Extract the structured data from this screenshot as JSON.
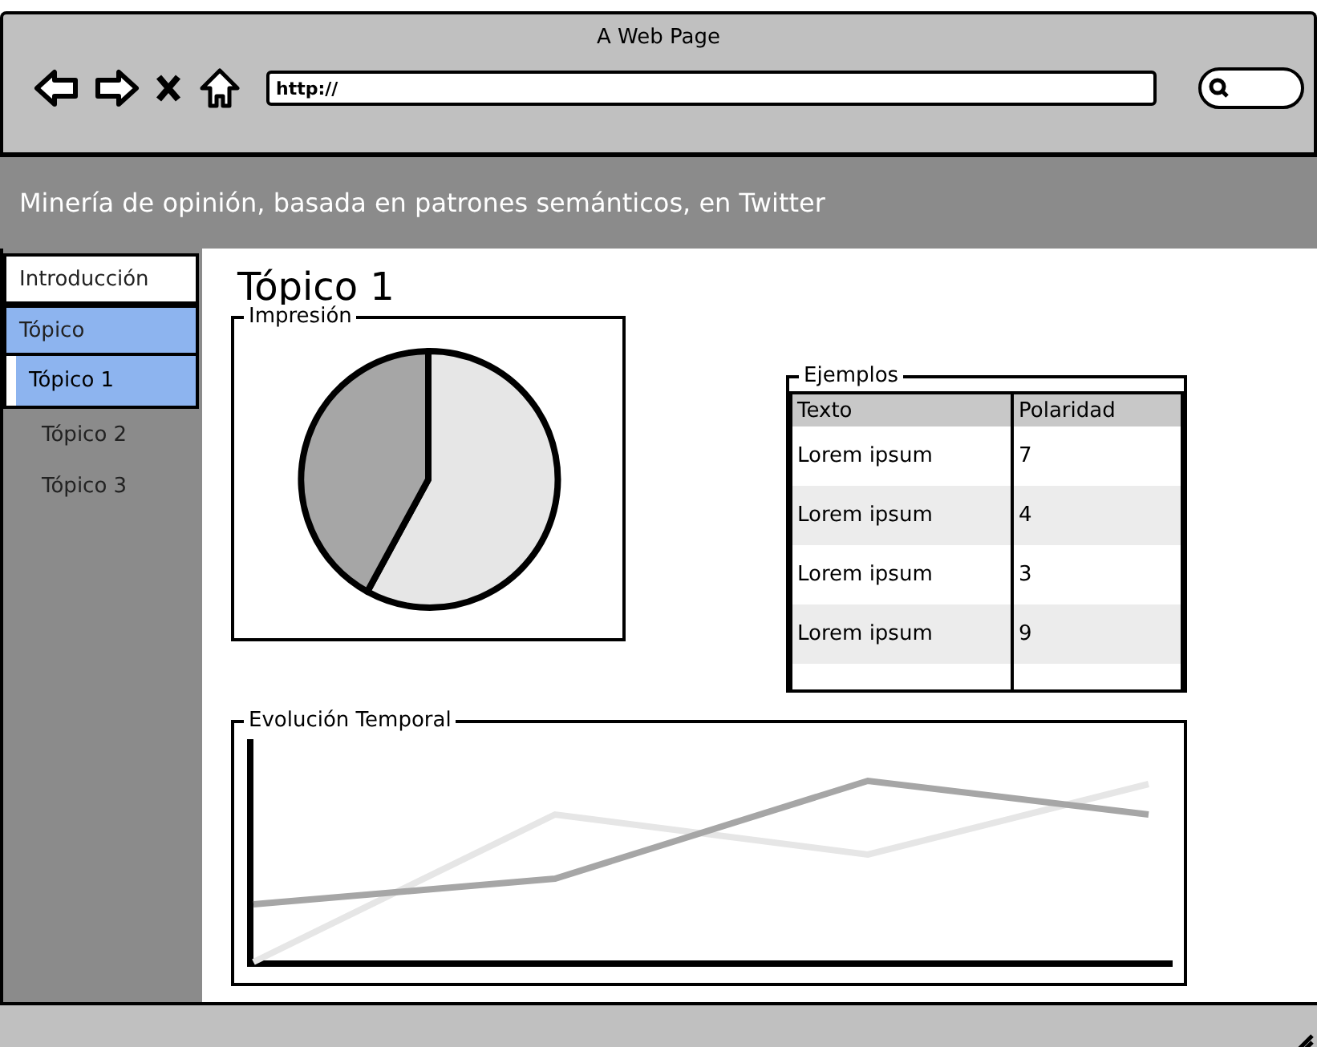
{
  "window": {
    "title": "A Web Page"
  },
  "address_bar": {
    "value": "http://"
  },
  "header": {
    "title": "Minería de opinión, basada en patrones semánticos, en Twitter"
  },
  "sidebar": {
    "items": [
      {
        "label": "Introducción",
        "expanded": false
      },
      {
        "label": "Tópico",
        "expanded": true,
        "children": [
          {
            "label": "Tópico 1",
            "selected": true
          },
          {
            "label": "Tópico 2",
            "selected": false
          },
          {
            "label": "Tópico 3",
            "selected": false
          }
        ]
      }
    ]
  },
  "page": {
    "heading": "Tópico 1"
  },
  "impression": {
    "label": "Impresión"
  },
  "examples": {
    "label": "Ejemplos",
    "columns": [
      "Texto",
      "Polaridad"
    ],
    "rows": [
      [
        "Lorem ipsum",
        "7"
      ],
      [
        "Lorem ipsum",
        "4"
      ],
      [
        "Lorem ipsum",
        "3"
      ],
      [
        "Lorem ipsum",
        "9"
      ]
    ]
  },
  "evolution": {
    "label": "Evolución Temporal"
  }
}
